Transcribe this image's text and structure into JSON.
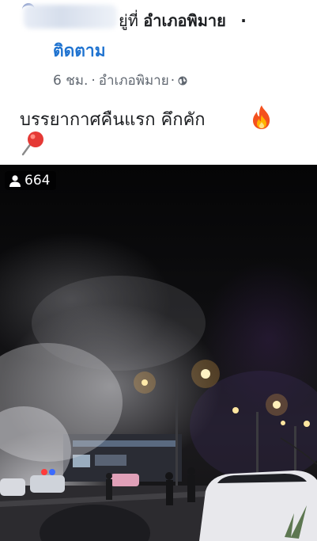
{
  "post": {
    "location_prefix": "ยู่ที่",
    "location": "อำเภอพิมาย",
    "separator": "·",
    "follow_label": "ติดตาม",
    "time_ago": "6 ชม.",
    "meta_sep1": "·",
    "meta_location": "อำเภอพิมาย",
    "meta_sep2": "·",
    "privacy_icon": "globe-icon",
    "text": "บรรยากาศคืนแรก คึกคัก",
    "emojis": [
      "fire-icon",
      "pushpin-icon"
    ]
  },
  "video": {
    "viewer_count": "664",
    "viewer_icon": "person-icon"
  },
  "colors": {
    "follow": "#1f73d0",
    "meta": "#606770"
  }
}
